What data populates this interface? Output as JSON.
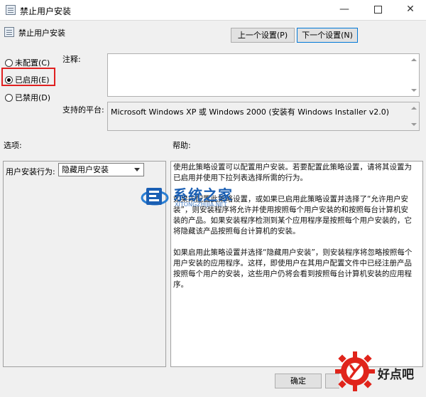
{
  "window": {
    "title": "禁止用户安装",
    "minimize": "—",
    "close": "✕"
  },
  "policy_name": "禁止用户安装",
  "nav": {
    "prev_label": "上一个设置(P)",
    "next_label": "下一个设置(N)"
  },
  "state": {
    "options": [
      {
        "label": "未配置(C)",
        "checked": false
      },
      {
        "label": "已启用(E)",
        "checked": true
      },
      {
        "label": "已禁用(D)",
        "checked": false
      }
    ]
  },
  "comment_label": "注释:",
  "platform_label": "支持的平台:",
  "platform_value": "Microsoft Windows XP 或 Windows 2000 (安装有 Windows Installer v2.0)",
  "options_label": "选项:",
  "help_label": "帮助:",
  "options": {
    "behavior_label": "用户安装行为:",
    "behavior_value": "隐藏用户安装"
  },
  "help": {
    "p1": "使用此策略设置可以配置用户安装。若要配置此策略设置，请将其设置为已启用并使用下拉列表选择所需的行为。",
    "p2": "如果未配置此策略设置，或如果已启用此策略设置并选择了“允许用户安装”，则安装程序将允许并使用按照每个用户安装的和按照每台计算机安装的产品。如果安装程序检测到某个应用程序是按照每个用户安装的，它将隐藏该产品按照每台计算机的安装。",
    "p3": "如果启用此策略设置并选择“隐藏用户安装”，则安装程序将忽略按照每个用户安装的应用程序。这样，即使用户在其用户配置文件中已经注册产品按照每个用户的安装，这些用户仍将会看到按照每台计算机安装的应用程序。"
  },
  "footer": {
    "ok_label": "确定",
    "cancel_label": ""
  },
  "watermark": {
    "title": "系统之家",
    "url": "XITONGZHIJIA.NET"
  },
  "brand": {
    "text": "好点吧"
  },
  "colors": {
    "highlight": "#e02020",
    "accent": "#0078d7",
    "watermark": "#1a5fb4",
    "brand_red": "#e0241b"
  }
}
